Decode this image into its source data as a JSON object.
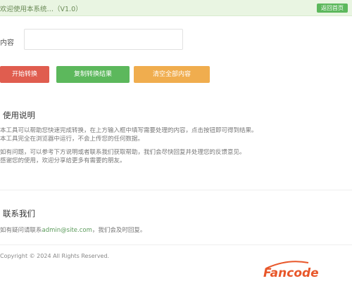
{
  "header": {
    "title": "欢迎使用本系统…（V1.0）",
    "badge": "返回首页"
  },
  "form": {
    "label": "内容",
    "input_value": ""
  },
  "buttons": {
    "red": "开始转换",
    "green": "复制转换结果",
    "orange": "清空全部内容"
  },
  "section1": {
    "title": "使用说明",
    "lines": [
      "本工具可以帮助您快速完成转换，在上方输入框中填写需要处理的内容，点击按钮即可得到结果。",
      "本工具完全在浏览器中运行，不会上传您的任何数据。",
      "如有问题，可以参考下方说明或者联系我们获取帮助，我们会尽快回复并处理您的反馈意见。",
      "感谢您的使用，欢迎分享给更多有需要的朋友。"
    ]
  },
  "section2": {
    "title": "联系我们",
    "prefix": "如有疑问请联系",
    "link": "admin@site.com",
    "suffix": "，我们会及时回复。"
  },
  "footer": {
    "text": "Copyright © 2024 All Rights Reserved."
  },
  "logo": {
    "text": "Fancode"
  },
  "colors": {
    "accent_green": "#5cb85c",
    "accent_red": "#e05d4f",
    "accent_orange": "#f0ad4e"
  }
}
